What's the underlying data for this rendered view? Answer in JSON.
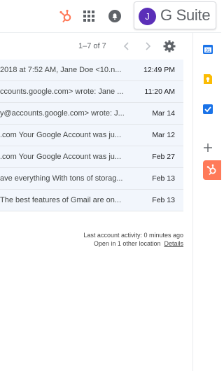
{
  "header": {
    "avatar_initial": "J",
    "product_name": "G Suite"
  },
  "toolbar": {
    "pager_text": "1–7 of 7"
  },
  "emails": [
    {
      "snippet": "2018 at 7:52 AM, Jane Doe <10.n...",
      "date": "12:49 PM"
    },
    {
      "snippet": "ccounts.google.com> wrote: Jane ...",
      "date": "11:20 AM"
    },
    {
      "snippet": "y@accounts.google.com> wrote: J...",
      "date": "Mar 14"
    },
    {
      "snippet": ".com Your Google Account was ju...",
      "date": "Mar 12"
    },
    {
      "snippet": ".com Your Google Account was ju...",
      "date": "Feb 27"
    },
    {
      "snippet": "ave everything With tons of storag...",
      "date": "Feb 13"
    },
    {
      "snippet": "The best features of Gmail are on...",
      "date": "Feb 13"
    }
  ],
  "footer": {
    "activity_text": "Last account activity: 0 minutes ago",
    "location_text": "Open in 1 other location",
    "details_label": "Details"
  },
  "colors": {
    "hubspot_orange": "#ff7a59",
    "avatar_purple": "#5b2fb8",
    "row_background": "#f2f6fc"
  },
  "icons": [
    "hubspot-icon",
    "apps-grid-icon",
    "notifications-icon",
    "chevron-left-icon",
    "chevron-right-icon",
    "gear-icon",
    "calendar-icon",
    "keep-icon",
    "tasks-icon",
    "add-icon",
    "hubspot-side-icon"
  ]
}
